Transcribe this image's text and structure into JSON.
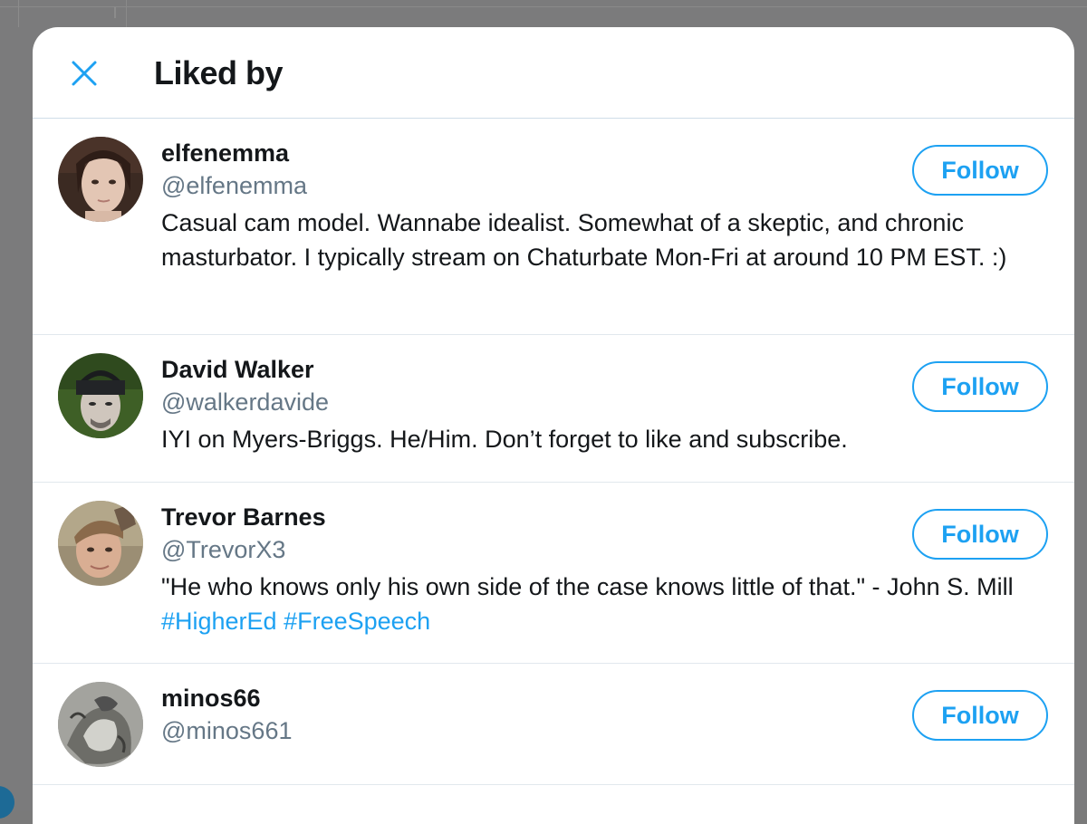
{
  "modal": {
    "title": "Liked by",
    "close_icon": "close-icon"
  },
  "colors": {
    "accent": "#1da1f2",
    "text_primary": "#14171a",
    "text_secondary": "#657786",
    "divider": "#e1e8ed"
  },
  "users": [
    {
      "name": "elfenemma",
      "handle": "@elfenemma",
      "bio": "Casual cam model. Wannabe idealist. Somewhat of a skeptic, and chronic masturbator. I typically stream on Chaturbate Mon-Fri at around 10 PM EST. :)",
      "follow_label": "Follow"
    },
    {
      "name": "David Walker",
      "handle": "@walkerdavide",
      "bio": "IYI on Myers-Briggs. He/Him. Don’t forget to like and subscribe.",
      "follow_label": "Follow"
    },
    {
      "name": "Trevor Barnes",
      "handle": "@TrevorX3",
      "bio_text": "\"He who knows only his own side of the case knows little of that.\" - John S. Mill",
      "bio_hashtags": [
        "#HigherEd",
        "#FreeSpeech"
      ],
      "follow_label": "Follow"
    },
    {
      "name": "minos66",
      "handle": "@minos661",
      "bio": "",
      "follow_label": "Follow"
    }
  ]
}
